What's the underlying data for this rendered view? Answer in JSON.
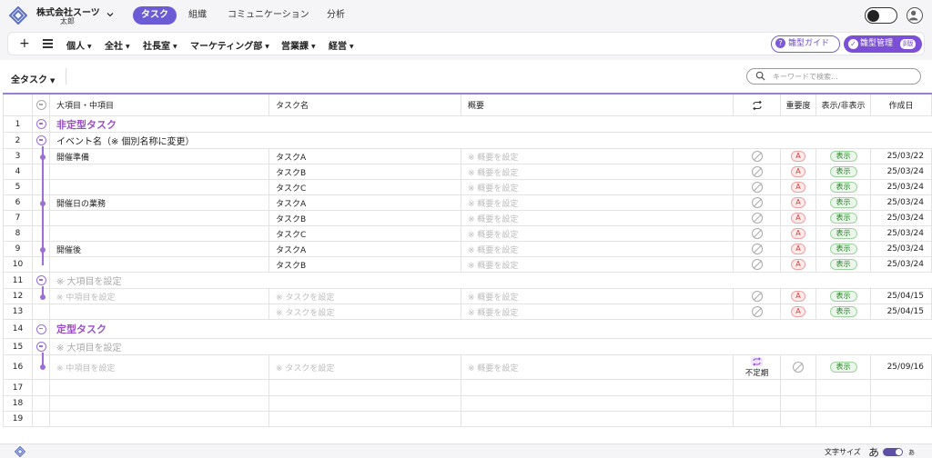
{
  "header": {
    "company": "株式会社スーツ",
    "user": "太郎",
    "tabs": [
      {
        "label": "タスク",
        "active": true
      },
      {
        "label": "組織",
        "active": false
      },
      {
        "label": "コミュニケーション",
        "active": false
      },
      {
        "label": "分析",
        "active": false
      }
    ]
  },
  "filterbar": {
    "add": "+",
    "items": [
      "個人",
      "全社",
      "社長室",
      "マーケティング部",
      "営業課",
      "経営"
    ],
    "guide_label": "雛型ガイド",
    "manage_label": "雛型管理",
    "beta_label": "β版"
  },
  "toolbar": {
    "all_tasks": "全タスク",
    "search_placeholder": "キーワードで検索..."
  },
  "table": {
    "headers": {
      "category": "大項目・中項目",
      "task": "タスク名",
      "summary": "概要",
      "priority": "重要度",
      "visibility": "表示/非表示",
      "created": "作成日"
    },
    "rows": [
      {
        "no": "1",
        "type": "section",
        "label": "非定型タスク"
      },
      {
        "no": "2",
        "type": "major",
        "label": "イベント名（※ 個別名称に変更）"
      },
      {
        "no": "3",
        "type": "task",
        "mid": "開催準備",
        "task": "タスクA",
        "summary": "※ 概要を設定",
        "priority": "A",
        "visibility": "表示",
        "date": "25/03/22"
      },
      {
        "no": "4",
        "type": "task",
        "mid": "",
        "task": "タスクB",
        "summary": "※ 概要を設定",
        "priority": "A",
        "visibility": "表示",
        "date": "25/03/24"
      },
      {
        "no": "5",
        "type": "task",
        "mid": "",
        "task": "タスクC",
        "summary": "※ 概要を設定",
        "priority": "A",
        "visibility": "表示",
        "date": "25/03/24"
      },
      {
        "no": "6",
        "type": "task",
        "mid": "開催日の業務",
        "task": "タスクA",
        "summary": "※ 概要を設定",
        "priority": "A",
        "visibility": "表示",
        "date": "25/03/24"
      },
      {
        "no": "7",
        "type": "task",
        "mid": "",
        "task": "タスクB",
        "summary": "※ 概要を設定",
        "priority": "A",
        "visibility": "表示",
        "date": "25/03/24"
      },
      {
        "no": "8",
        "type": "task",
        "mid": "",
        "task": "タスクC",
        "summary": "※ 概要を設定",
        "priority": "A",
        "visibility": "表示",
        "date": "25/03/24"
      },
      {
        "no": "9",
        "type": "task",
        "mid": "開催後",
        "task": "タスクA",
        "summary": "※ 概要を設定",
        "priority": "A",
        "visibility": "表示",
        "date": "25/03/24"
      },
      {
        "no": "10",
        "type": "task",
        "mid": "",
        "task": "タスクB",
        "summary": "※ 概要を設定",
        "priority": "A",
        "visibility": "表示",
        "date": "25/03/24"
      },
      {
        "no": "11",
        "type": "major-ph",
        "label": "※ 大項目を設定"
      },
      {
        "no": "12",
        "type": "task-ph",
        "mid": "※ 中項目を設定",
        "task": "※ タスクを設定",
        "summary": "※ 概要を設定",
        "priority": "A",
        "visibility": "表示",
        "date": "25/04/15"
      },
      {
        "no": "13",
        "type": "task-ph",
        "mid": "",
        "task": "※ タスクを設定",
        "summary": "※ 概要を設定",
        "priority": "A",
        "visibility": "表示",
        "date": "25/04/15"
      },
      {
        "no": "14",
        "type": "section",
        "label": "定型タスク"
      },
      {
        "no": "15",
        "type": "major-ph",
        "label": "※ 大項目を設定"
      },
      {
        "no": "16",
        "type": "task-rep",
        "mid": "※ 中項目を設定",
        "task": "※ タスクを設定",
        "summary": "※ 概要を設定",
        "repeat": "不定期",
        "visibility": "表示",
        "date": "25/09/16"
      },
      {
        "no": "17",
        "type": "empty"
      },
      {
        "no": "18",
        "type": "empty"
      },
      {
        "no": "19",
        "type": "empty"
      }
    ]
  },
  "footer": {
    "font_size_label": "文字サイズ",
    "font_big": "あ",
    "font_small": "あ"
  },
  "colors": {
    "accent": "#6b5cd6",
    "section": "#9b4fc6",
    "priority": "#d43c3c",
    "visible": "#2a7a2a"
  }
}
